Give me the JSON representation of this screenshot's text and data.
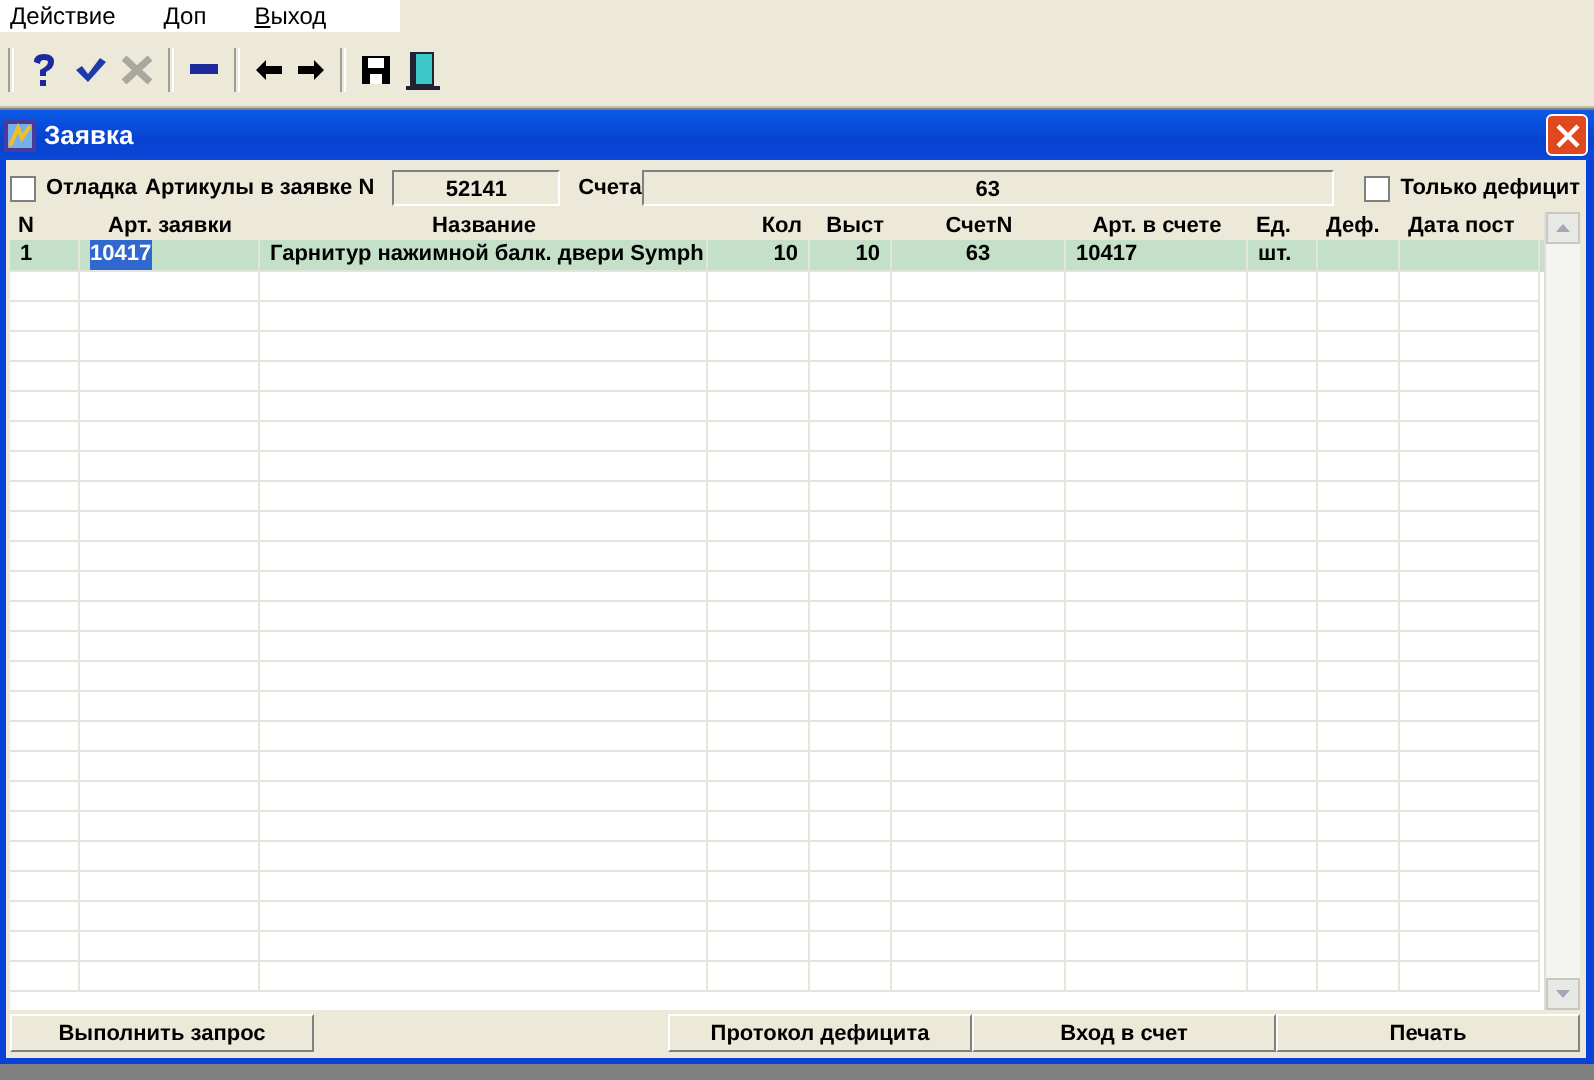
{
  "menu": [
    {
      "label": "Действие"
    },
    {
      "label": "Доп"
    },
    {
      "label": "Выход"
    }
  ],
  "toolbar": [
    {
      "kind": "help",
      "disabled": false
    },
    {
      "kind": "accept",
      "disabled": false
    },
    {
      "kind": "cancel",
      "disabled": true
    },
    {
      "kind": "sep"
    },
    {
      "kind": "remove",
      "disabled": false
    },
    {
      "kind": "sep"
    },
    {
      "kind": "back",
      "disabled": false
    },
    {
      "kind": "forward",
      "disabled": false
    },
    {
      "kind": "sep"
    },
    {
      "kind": "save",
      "disabled": false
    },
    {
      "kind": "exit",
      "disabled": false
    }
  ],
  "window": {
    "title": "Заявка"
  },
  "debug_checkbox": {
    "label": "Отладка",
    "checked": false
  },
  "request_field": {
    "label": "Артикулы в заявке N",
    "value": "52141"
  },
  "invoices_field": {
    "label": "Счета",
    "value": "63"
  },
  "deficit_checkbox": {
    "label": "Только дефицит",
    "checked": false
  },
  "table": {
    "columns": [
      "N",
      "Арт. заявки",
      "Название",
      "Кол",
      "Выст",
      "СчетN",
      "Арт. в счете",
      "Ед.",
      "Деф.",
      "Дата пост"
    ],
    "rows": [
      {
        "selected": true,
        "cells": [
          {
            "text": "1",
            "focused": false
          },
          {
            "text": "10417",
            "focused": true
          },
          {
            "text": "Гарнитур нажимной балк. двери Symph",
            "focused": false
          },
          {
            "text": "10",
            "focused": false
          },
          {
            "text": "10",
            "focused": false
          },
          {
            "text": "63",
            "focused": false
          },
          {
            "text": "10417",
            "focused": false
          },
          {
            "text": "шт.",
            "focused": false
          }
        ]
      }
    ]
  },
  "left_buttons": [
    "Выполнить запрос"
  ],
  "right_buttons": [
    "Протокол дефицита",
    "Вход в счет",
    "Печать"
  ]
}
